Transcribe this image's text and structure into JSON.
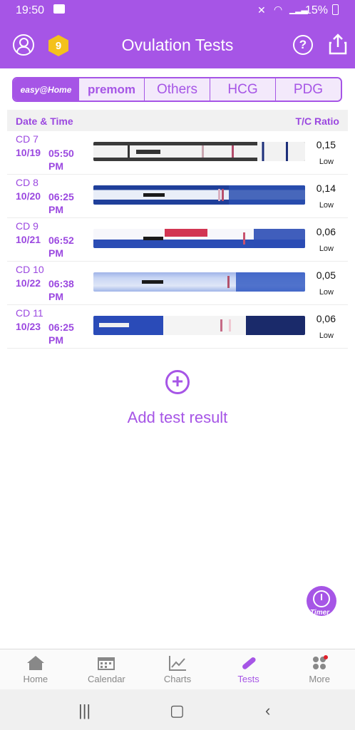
{
  "status_bar": {
    "time": "19:50",
    "battery": "15%"
  },
  "app_bar": {
    "title": "Ovulation Tests",
    "badge_count": "9"
  },
  "brand_tabs": [
    {
      "label": "easy@Home",
      "active": true
    },
    {
      "label": "premom",
      "active": false
    },
    {
      "label": "Others",
      "active": false
    },
    {
      "label": "HCG",
      "active": false
    },
    {
      "label": "PDG",
      "active": false
    }
  ],
  "table": {
    "col_date": "Date & Time",
    "col_ratio": "T/C Ratio",
    "rows": [
      {
        "cd": "CD 7",
        "date": "10/19",
        "time": "05:50 PM",
        "ratio": "0,15",
        "level": "Low"
      },
      {
        "cd": "CD 8",
        "date": "10/20",
        "time": "06:25 PM",
        "ratio": "0,14",
        "level": "Low"
      },
      {
        "cd": "CD 9",
        "date": "10/21",
        "time": "06:52 PM",
        "ratio": "0,06",
        "level": "Low"
      },
      {
        "cd": "CD 10",
        "date": "10/22",
        "time": "06:38 PM",
        "ratio": "0,05",
        "level": "Low"
      },
      {
        "cd": "CD 11",
        "date": "10/23",
        "time": "06:25 PM",
        "ratio": "0,06",
        "level": "Low"
      }
    ]
  },
  "add_result": {
    "label": "Add test result"
  },
  "timer": {
    "label": "Timer"
  },
  "bottom_nav": [
    {
      "label": "Home",
      "icon": "home-icon",
      "active": false
    },
    {
      "label": "Calendar",
      "icon": "calendar-icon",
      "active": false
    },
    {
      "label": "Charts",
      "icon": "chart-icon",
      "active": false
    },
    {
      "label": "Tests",
      "icon": "test-strip-icon",
      "active": true
    },
    {
      "label": "More",
      "icon": "grid-icon",
      "active": false
    }
  ],
  "colors": {
    "accent": "#a655e6",
    "text_purple": "#9b48e0"
  }
}
